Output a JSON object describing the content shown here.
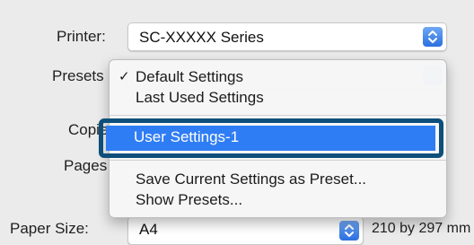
{
  "form": {
    "printer_label": "Printer:",
    "printer_value": "SC-XXXXX Series",
    "presets_label": "Presets",
    "copies_label": "Copie",
    "pages_label": "Pages",
    "paper_size_label": "Paper Size:",
    "paper_size_value": "A4",
    "paper_size_dimensions": "210 by 297 mm"
  },
  "presets_menu": {
    "items": [
      {
        "label": "Default Settings",
        "checked": true
      },
      {
        "label": "Last Used Settings",
        "checked": false
      },
      {
        "label": "User Settings-1",
        "checked": false,
        "highlighted": true
      },
      {
        "label": "Save Current Settings as Preset...",
        "checked": false
      },
      {
        "label": "Show Presets...",
        "checked": false
      }
    ],
    "checkmark": "✓"
  },
  "colors": {
    "accent": "#2f7df4",
    "highlight_outline": "#0d4f7a"
  },
  "icons": {
    "stepper": "up-down-chevron-icon"
  }
}
